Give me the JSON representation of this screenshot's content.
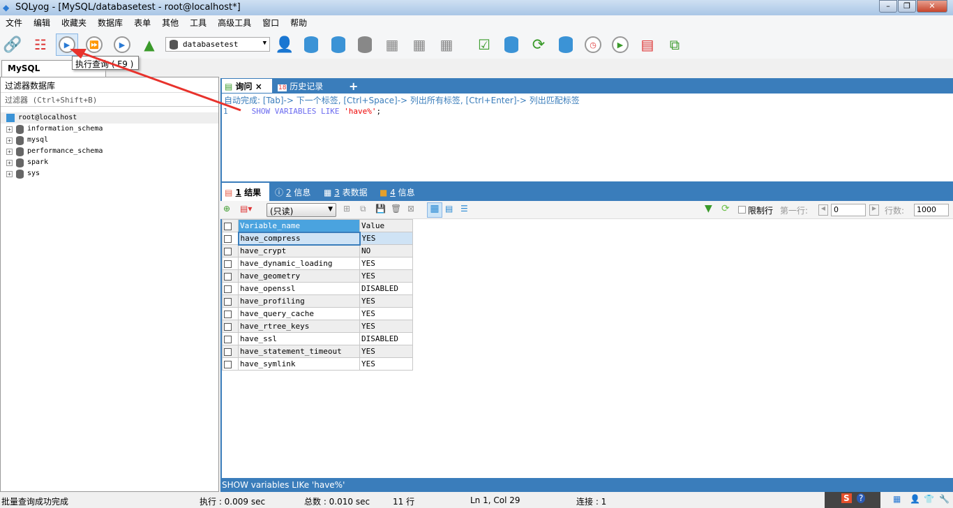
{
  "window": {
    "title": "SQLyog - [MySQL/databasetest - root@localhost*]"
  },
  "menu": [
    "文件",
    "编辑",
    "收藏夹",
    "数据库",
    "表单",
    "其他",
    "工具",
    "高级工具",
    "窗口",
    "帮助"
  ],
  "toolbar": {
    "database": "databasetest",
    "tooltip": "执行查询 ( F9 )"
  },
  "connection_tab": "MySQL",
  "object_browser": {
    "header": "过滤器数据库",
    "filter_placeholder": "过滤器 (Ctrl+Shift+B)",
    "root": "root@localhost",
    "databases": [
      "information_schema",
      "mysql",
      "performance_schema",
      "spark",
      "sys"
    ]
  },
  "query_tabs": [
    {
      "label": "询问",
      "close": "×"
    },
    {
      "label": "历史记录"
    }
  ],
  "add_tab": "+",
  "editor": {
    "hint": "自动完成: [Tab]-> 下一个标签, [Ctrl+Space]-> 列出所有标签, [Ctrl+Enter]-> 列出匹配标签",
    "line": "1",
    "code_kw": "SHOW VARIABLES LIKE ",
    "code_str": "'have%'",
    "code_end": ";"
  },
  "result_tabs": [
    {
      "num": "1",
      "label": "结果"
    },
    {
      "num": "2",
      "label": "信息"
    },
    {
      "num": "3",
      "label": "表数据"
    },
    {
      "num": "4",
      "label": "信息"
    }
  ],
  "result_toolbar": {
    "mode": "(只读)",
    "limit_label": "限制行",
    "first_row_label": "第一行:",
    "first_row": "0",
    "rows_label": "行数:",
    "rows": "1000"
  },
  "grid": {
    "columns": [
      "Variable_name",
      "Value"
    ],
    "rows": [
      [
        "have_compress",
        "YES"
      ],
      [
        "have_crypt",
        "NO"
      ],
      [
        "have_dynamic_loading",
        "YES"
      ],
      [
        "have_geometry",
        "YES"
      ],
      [
        "have_openssl",
        "DISABLED"
      ],
      [
        "have_profiling",
        "YES"
      ],
      [
        "have_query_cache",
        "YES"
      ],
      [
        "have_rtree_keys",
        "YES"
      ],
      [
        "have_ssl",
        "DISABLED"
      ],
      [
        "have_statement_timeout",
        "YES"
      ],
      [
        "have_symlink",
        "YES"
      ]
    ]
  },
  "sql_status": "SHOW variables LIKe 'have%'",
  "status": {
    "message": "批量查询成功完成",
    "exec": "执行 : 0.009 sec",
    "total": "总数 : 0.010 sec",
    "rows": "11 行",
    "pos": "Ln 1, Col 29",
    "conn": "连接 : 1"
  }
}
